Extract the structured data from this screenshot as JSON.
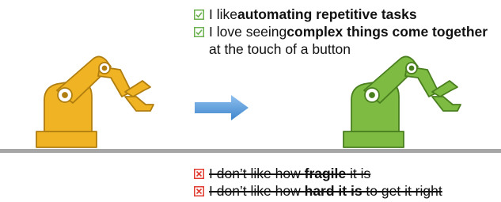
{
  "pros": [
    {
      "icon": "green-checkbox-icon",
      "parts": [
        {
          "t": "I like ",
          "b": false
        },
        {
          "t": "automating repetitive tasks",
          "b": true
        }
      ]
    },
    {
      "icon": "green-checkbox-icon",
      "parts": [
        {
          "t": "I love seeing ",
          "b": false
        },
        {
          "t": "complex things come together",
          "b": true
        }
      ],
      "continuation": "at the touch of a button"
    }
  ],
  "cons": [
    {
      "icon": "red-x-box-icon",
      "parts": [
        {
          "t": "I don’t like how ",
          "b": false
        },
        {
          "t": "fragile",
          "b": true
        },
        {
          "t": " it is",
          "b": false
        }
      ]
    },
    {
      "icon": "red-x-box-icon",
      "parts": [
        {
          "t": "I don’t like how ",
          "b": false
        },
        {
          "t": "hard it is",
          "b": true
        },
        {
          "t": " to get it right",
          "b": false
        }
      ]
    }
  ],
  "colors": {
    "robot_left": "#f0b323",
    "robot_left_stroke": "#b07e10",
    "robot_right": "#7dbb42",
    "robot_right_stroke": "#4a7f1f",
    "arrow": "#5b9bd5",
    "check": "#6ab04c",
    "cross": "#e03c31",
    "ground": "#a6a6a6"
  }
}
